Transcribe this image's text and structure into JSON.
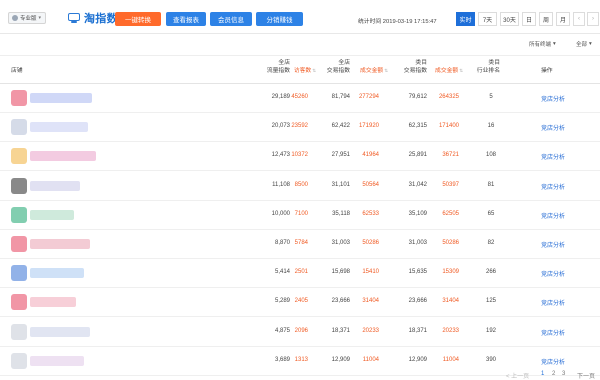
{
  "topbar": {
    "edition_label": "专业版",
    "logo_text": "淘指数",
    "buttons": {
      "convert": "一键转换",
      "report": "查看报表",
      "member": "会员信息",
      "share": "分销赚钱"
    },
    "stat_time": "统计时间 2019-03-19 17:15:47",
    "periods": {
      "realtime": "实时",
      "d7": "7天",
      "d30": "30天",
      "day": "日",
      "week": "周",
      "month": "月",
      "prev": "‹",
      "next": "›"
    }
  },
  "filters": {
    "terminal": "所有终端",
    "scope": "全部"
  },
  "table": {
    "headers": {
      "shop": "店铺",
      "traffic_l1": "全店",
      "traffic_l2": "流量指数",
      "visitors": "访客数",
      "trade_l1": "全店",
      "trade_l2": "交易指数",
      "amount1": "成交金额",
      "cat_trade_l1": "类目",
      "cat_trade_l2": "交易指数",
      "amount2": "成交金额",
      "rank_l1": "类目",
      "rank_l2": "行业排名",
      "action": "操作"
    },
    "rows": [
      {
        "traffic": "29,189",
        "visitors": "45260",
        "trade": "81,794",
        "amount": "277294",
        "cat_trade": "79,612",
        "cat_amount": "264325",
        "rank": "5",
        "action": "竞店分析"
      },
      {
        "traffic": "20,073",
        "visitors": "23592",
        "trade": "62,422",
        "amount": "171920",
        "cat_trade": "62,315",
        "cat_amount": "171400",
        "rank": "16",
        "action": "竞店分析"
      },
      {
        "traffic": "12,473",
        "visitors": "10372",
        "trade": "27,951",
        "amount": "41964",
        "cat_trade": "25,891",
        "cat_amount": "36721",
        "rank": "108",
        "action": "竞店分析"
      },
      {
        "traffic": "11,108",
        "visitors": "8500",
        "trade": "31,101",
        "amount": "50564",
        "cat_trade": "31,042",
        "cat_amount": "50397",
        "rank": "81",
        "action": "竞店分析"
      },
      {
        "traffic": "10,000",
        "visitors": "7100",
        "trade": "35,118",
        "amount": "62533",
        "cat_trade": "35,109",
        "cat_amount": "62505",
        "rank": "65",
        "action": "竞店分析"
      },
      {
        "traffic": "8,870",
        "visitors": "5784",
        "trade": "31,003",
        "amount": "50286",
        "cat_trade": "31,003",
        "cat_amount": "50286",
        "rank": "82",
        "action": "竞店分析"
      },
      {
        "traffic": "5,414",
        "visitors": "2501",
        "trade": "15,698",
        "amount": "15410",
        "cat_trade": "15,635",
        "cat_amount": "15309",
        "rank": "266",
        "action": "竞店分析"
      },
      {
        "traffic": "5,289",
        "visitors": "2405",
        "trade": "23,666",
        "amount": "31404",
        "cat_trade": "23,666",
        "cat_amount": "31404",
        "rank": "125",
        "action": "竞店分析"
      },
      {
        "traffic": "4,875",
        "visitors": "2096",
        "trade": "18,371",
        "amount": "20233",
        "cat_trade": "18,371",
        "cat_amount": "20233",
        "rank": "192",
        "action": "竞店分析"
      },
      {
        "traffic": "3,689",
        "visitors": "1313",
        "trade": "12,909",
        "amount": "11004",
        "cat_trade": "12,909",
        "cat_amount": "11004",
        "rank": "390",
        "action": "竞店分析"
      }
    ],
    "avatar_colors": [
      "#e8506a",
      "#b9c3d8",
      "#f2b84b",
      "#3b3b3b",
      "#2fae7c",
      "#e8506a",
      "#4a7fd8",
      "#e8506a",
      "#c9cfd8",
      "#c9cfd8"
    ],
    "name_colors": [
      "#a9b8f0",
      "#c4ccf2",
      "#e9a0c8",
      "#c8c8e8",
      "#a8d8c0",
      "#e9a0b0",
      "#a8c8f0",
      "#f0a8b8",
      "#c8d0e8",
      "#e0c8e8"
    ]
  },
  "pagination": {
    "prev": "< 上一页",
    "p1": "1",
    "p2": "2",
    "p3": "3",
    "next": "下一页 >"
  },
  "colors": {
    "brand_blue": "#2d82e6",
    "accent_orange": "#ff6a2b",
    "value_orange": "#f05a23",
    "link_blue": "#2a6fd6"
  }
}
